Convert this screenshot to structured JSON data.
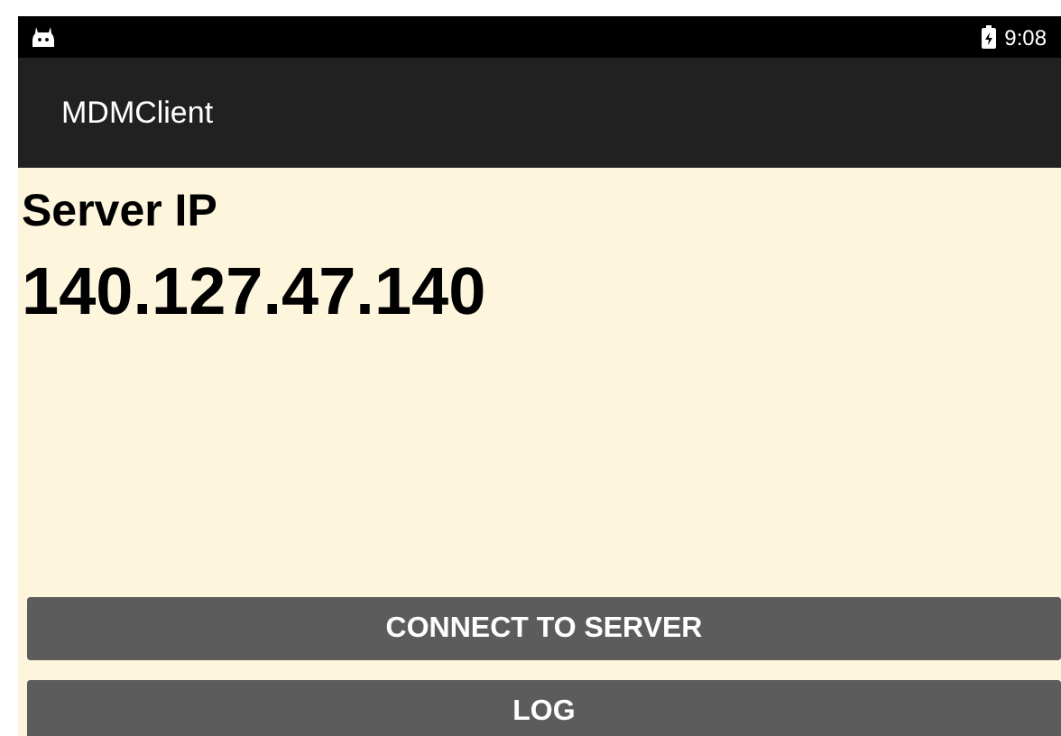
{
  "status_bar": {
    "time": "9:08"
  },
  "app_bar": {
    "title": "MDMClient"
  },
  "content": {
    "label": "Server IP",
    "value": "140.127.47.140"
  },
  "buttons": [
    "CONNECT TO SERVER",
    "LOG"
  ]
}
